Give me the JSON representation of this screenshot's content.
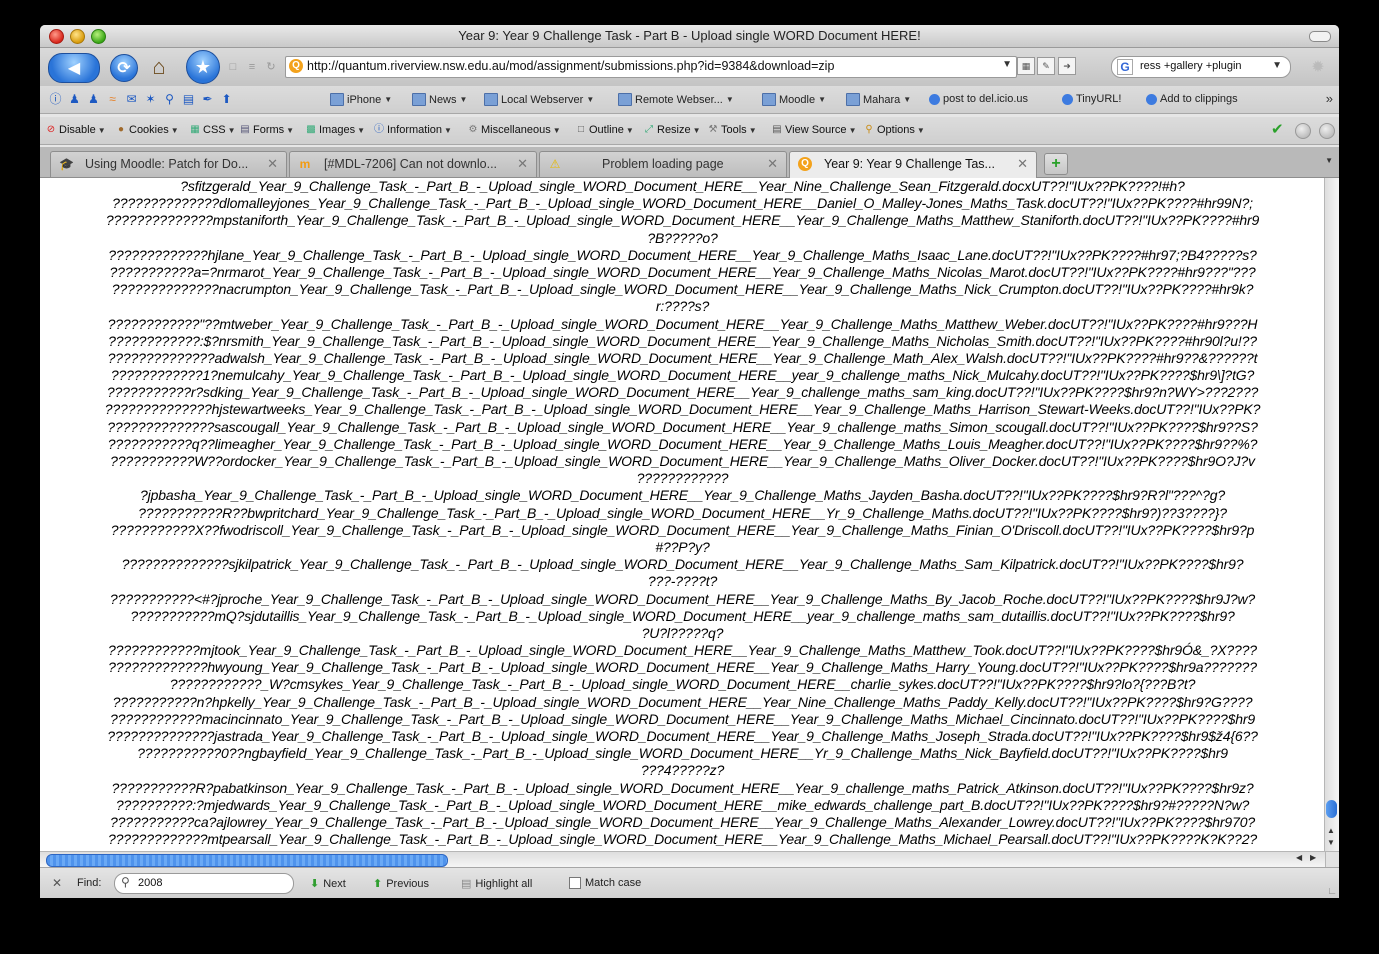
{
  "window": {
    "title": "Year 9: Year 9 Challenge Task - Part B - Upload single WORD Document HERE!"
  },
  "navbar": {
    "url": "http://quantum.riverview.nsw.edu.au/mod/assignment/submissions.php?id=9384&download=zip",
    "search_value": "ress +gallery +plugin"
  },
  "bookmarks": [
    {
      "label": "iPhone",
      "icon": "folder-icon"
    },
    {
      "label": "News",
      "icon": "folder-icon"
    },
    {
      "label": "Local Webserver",
      "icon": "folder-icon"
    },
    {
      "label": "Remote Webser...",
      "icon": "folder-icon"
    },
    {
      "label": "Moodle",
      "icon": "folder-icon"
    },
    {
      "label": "Mahara",
      "icon": "folder-icon"
    },
    {
      "label": "post to del.icio.us",
      "icon": "bookmarklet-icon"
    },
    {
      "label": "TinyURL!",
      "icon": "bookmarklet-icon"
    },
    {
      "label": "Add to clippings",
      "icon": "bookmarklet-icon"
    }
  ],
  "devbar": [
    {
      "label": "Disable",
      "icon": "disable-icon"
    },
    {
      "label": "Cookies",
      "icon": "cookies-icon"
    },
    {
      "label": "CSS",
      "icon": "css-icon"
    },
    {
      "label": "Forms",
      "icon": "forms-icon"
    },
    {
      "label": "Images",
      "icon": "images-icon"
    },
    {
      "label": "Information",
      "icon": "information-icon"
    },
    {
      "label": "Miscellaneous",
      "icon": "miscellaneous-icon"
    },
    {
      "label": "Outline",
      "icon": "outline-icon"
    },
    {
      "label": "Resize",
      "icon": "resize-icon"
    },
    {
      "label": "Tools",
      "icon": "tools-icon"
    },
    {
      "label": "View Source",
      "icon": "view-source-icon"
    },
    {
      "label": "Options",
      "icon": "options-icon"
    }
  ],
  "tabs": [
    {
      "label": "Using Moodle: Patch for Do...",
      "icon": "moodle-icon",
      "active": false
    },
    {
      "label": "[#MDL-7206] Can not downlo...",
      "icon": "moodle-m-icon",
      "active": false
    },
    {
      "label": "Problem loading page",
      "icon": "warning-icon",
      "active": false
    },
    {
      "label": "Year 9: Year 9 Challenge Tas...",
      "icon": "site-icon",
      "active": true
    }
  ],
  "content_lines": [
    "?sfitzgerald_Year_9_Challenge_Task_-_Part_B_-_Upload_single_WORD_Document_HERE__Year_Nine_Challenge_Sean_Fitzgerald.docxUT??!\"IUx??PK????!#h?",
    "??????????????dlomalleyjones_Year_9_Challenge_Task_-_Part_B_-_Upload_single_WORD_Document_HERE__Daniel_O_Malley-Jones_Maths_Task.docUT??!\"IUx??PK????#hr99N?;",
    "??????????????mpstaniforth_Year_9_Challenge_Task_-_Part_B_-_Upload_single_WORD_Document_HERE__Year_9_Challenge_Maths_Matthew_Staniforth.docUT??!\"IUx??PK????#hr9",
    "?B?????o?",
    "?????????????hjlane_Year_9_Challenge_Task_-_Part_B_-_Upload_single_WORD_Document_HERE__Year_9_Challenge_Maths_Isaac_Lane.docUT??!\"IUx??PK????#hr97;?B4?????s?",
    "???????????a=?nrmarot_Year_9_Challenge_Task_-_Part_B_-_Upload_single_WORD_Document_HERE__Year_9_Challenge_Maths_Nicolas_Marot.docUT??!\"IUx??PK????#hr9???\"???",
    "??????????????nacrumpton_Year_9_Challenge_Task_-_Part_B_-_Upload_single_WORD_Document_HERE__Year_9_Challenge_Maths_Nick_Crumpton.docUT??!\"IUx??PK????#hr9k?",
    "r:????s?",
    "????????????\"??mtweber_Year_9_Challenge_Task_-_Part_B_-_Upload_single_WORD_Document_HERE__Year_9_Challenge_Maths_Matthew_Weber.docUT??!\"IUx??PK????#hr9???H",
    "????????????:$?nrsmith_Year_9_Challenge_Task_-_Part_B_-_Upload_single_WORD_Document_HERE__Year_9_Challenge_Maths_Nicholas_Smith.docUT??!\"IUx??PK????#hr90l?u!??",
    "??????????????adwalsh_Year_9_Challenge_Task_-_Part_B_-_Upload_single_WORD_Document_HERE__Year_9_Challenge_Math_Alex_Walsh.docUT??!\"IUx??PK????#hr9??&??????t",
    "????????????1?nemulcahy_Year_9_Challenge_Task_-_Part_B_-_Upload_single_WORD_Document_HERE__year_9_challenge_maths_Nick_Mulcahy.docUT??!\"IUx??PK????$hr9\\]?tG?",
    "???????????r?sdking_Year_9_Challenge_Task_-_Part_B_-_Upload_single_WORD_Document_HERE__Year_9_challenge_maths_sam_king.docUT??!\"IUx??PK????$hr9?n?WY>???2???",
    "??????????????hjstewartweeks_Year_9_Challenge_Task_-_Part_B_-_Upload_single_WORD_Document_HERE__Year_9_Challenge_Maths_Harrison_Stewart-Weeks.docUT??!\"IUx??PK?",
    "??????????????sascougall_Year_9_Challenge_Task_-_Part_B_-_Upload_single_WORD_Document_HERE__Year_9_challenge_maths_Simon_scougall.docUT??!\"IUx??PK????$hr9??S?",
    "???????????q??limeagher_Year_9_Challenge_Task_-_Part_B_-_Upload_single_WORD_Document_HERE__Year_9_Challenge_Maths_Louis_Meagher.docUT??!\"IUx??PK????$hr9??%?",
    "???????????W??ordocker_Year_9_Challenge_Task_-_Part_B_-_Upload_single_WORD_Document_HERE__Year_9_Challenge_Maths_Oliver_Docker.docUT??!\"IUx??PK????$hr9O?J?v",
    "????????????",
    "?jpbasha_Year_9_Challenge_Task_-_Part_B_-_Upload_single_WORD_Document_HERE__Year_9_Challenge_Maths_Jayden_Basha.docUT??!\"IUx??PK????$hr9?R?l\"???^?g?",
    "???????????R??bwpritchard_Year_9_Challenge_Task_-_Part_B_-_Upload_single_WORD_Document_HERE__Yr_9_Challenge_Maths.docUT??!\"IUx??PK????$hr9?)??3????}?",
    "???????????X??fwodriscoll_Year_9_Challenge_Task_-_Part_B_-_Upload_single_WORD_Document_HERE__Year_9_Challenge_Maths_Finian_O'Driscoll.docUT??!\"IUx??PK????$hr9?p",
    "#??P?y?",
    "??????????????sjkilpatrick_Year_9_Challenge_Task_-_Part_B_-_Upload_single_WORD_Document_HERE__Year_9_Challenge_Maths_Sam_Kilpatrick.docUT??!\"IUx??PK????$hr9?",
    "???-????t?",
    "???????????<#?jproche_Year_9_Challenge_Task_-_Part_B_-_Upload_single_WORD_Document_HERE__Year_9_Challenge_Maths_By_Jacob_Roche.docUT??!\"IUx??PK????$hr9J?w?",
    "???????????mQ?sjdutaillis_Year_9_Challenge_Task_-_Part_B_-_Upload_single_WORD_Document_HERE__year_9_challenge_maths_sam_dutaillis.docUT??!\"IUx??PK????$hr9?",
    "?U?l?????q?",
    "????????????mjtook_Year_9_Challenge_Task_-_Part_B_-_Upload_single_WORD_Document_HERE__Year_9_Challenge_Maths_Matthew_Took.docUT??!\"IUx??PK????$hr9Ó&_?X????",
    "?????????????hwyoung_Year_9_Challenge_Task_-_Part_B_-_Upload_single_WORD_Document_HERE__Year_9_Challenge_Maths_Harry_Young.docUT??!\"IUx??PK????$hr9a???????",
    "????????????_W?cmsykes_Year_9_Challenge_Task_-_Part_B_-_Upload_single_WORD_Document_HERE__charlie_sykes.docUT??!\"IUx??PK????$hr9?lo?{???B?t?",
    "???????????n?hpkelly_Year_9_Challenge_Task_-_Part_B_-_Upload_single_WORD_Document_HERE__Year_Nine_Challenge_Maths_Paddy_Kelly.docUT??!\"IUx??PK????$hr9?G????",
    "????????????macincinnato_Year_9_Challenge_Task_-_Part_B_-_Upload_single_WORD_Document_HERE__Year_9_Challenge_Maths_Michael_Cincinnato.docUT??!\"IUx??PK????$hr9",
    "??????????????jastrada_Year_9_Challenge_Task_-_Part_B_-_Upload_single_WORD_Document_HERE__Year_9_Challenge_Maths_Joseph_Strada.docUT??!\"IUx??PK????$hr9$ž4{6??",
    "???????????0??ngbayfield_Year_9_Challenge_Task_-_Part_B_-_Upload_single_WORD_Document_HERE__Yr_9_Challenge_Maths_Nick_Bayfield.docUT??!\"IUx??PK????$hr9",
    "???4?????z?",
    "???????????R?pabatkinson_Year_9_Challenge_Task_-_Part_B_-_Upload_single_WORD_Document_HERE__Year_9_challenge_maths_Patrick_Atkinson.docUT??!\"IUx??PK????$hr9z?",
    "??????????:?mjedwards_Year_9_Challenge_Task_-_Part_B_-_Upload_single_WORD_Document_HERE__mike_edwards_challenge_part_B.docUT??!\"IUx??PK????$hr9?#?????N?w?",
    "???????????ca?ajlowrey_Year_9_Challenge_Task_-_Part_B_-_Upload_single_WORD_Document_HERE__Year_9_Challenge_Maths_Alexander_Lowrey.docUT??!\"IUx??PK????$hr970?",
    "?????????????mtpearsall_Year_9_Challenge_Task_-_Part_B_-_Upload_single_WORD_Document_HERE__Year_9_Challenge_Maths_Michael_Pearsall.docUT??!\"IUx??PK????K?K??2?"
  ],
  "findbar": {
    "label": "Find:",
    "value": "2008",
    "next_label": "Next",
    "previous_label": "Previous",
    "highlight_label": "Highlight all",
    "match_case_label": "Match case"
  }
}
